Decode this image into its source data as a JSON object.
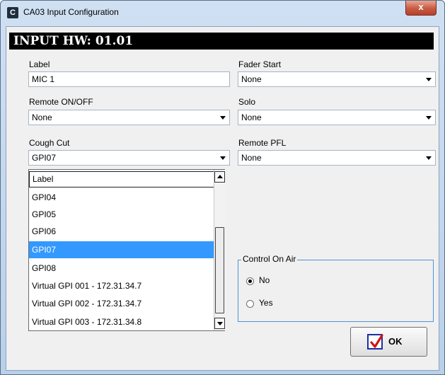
{
  "window": {
    "title": "CA03 Input Configuration",
    "app_icon_letter": "C",
    "close_label": "x"
  },
  "header": {
    "title": "INPUT HW: 01.01"
  },
  "fields": {
    "label": {
      "label": "Label",
      "value": "MIC 1"
    },
    "fader_start": {
      "label": "Fader Start",
      "value": "None"
    },
    "remote_onoff": {
      "label": "Remote ON/OFF",
      "value": "None"
    },
    "solo": {
      "label": "Solo",
      "value": "None"
    },
    "cough_cut": {
      "label": "Cough Cut",
      "value": "GPI07"
    },
    "remote_pfl": {
      "label": "Remote PFL",
      "value": "None"
    }
  },
  "dropdown": {
    "items": [
      "Label",
      "GPI04",
      "GPI05",
      "GPI06",
      "GPI07",
      "GPI08",
      "Virtual GPI 001 - 172.31.34.7",
      "Virtual GPI 002 - 172.31.34.7",
      "Virtual GPI 003 - 172.31.34.8"
    ],
    "selected": "GPI07"
  },
  "control_on_air": {
    "title": "Control On Air",
    "options": [
      "No",
      "Yes"
    ],
    "selected": "No"
  },
  "ok_button": {
    "label": "OK"
  }
}
